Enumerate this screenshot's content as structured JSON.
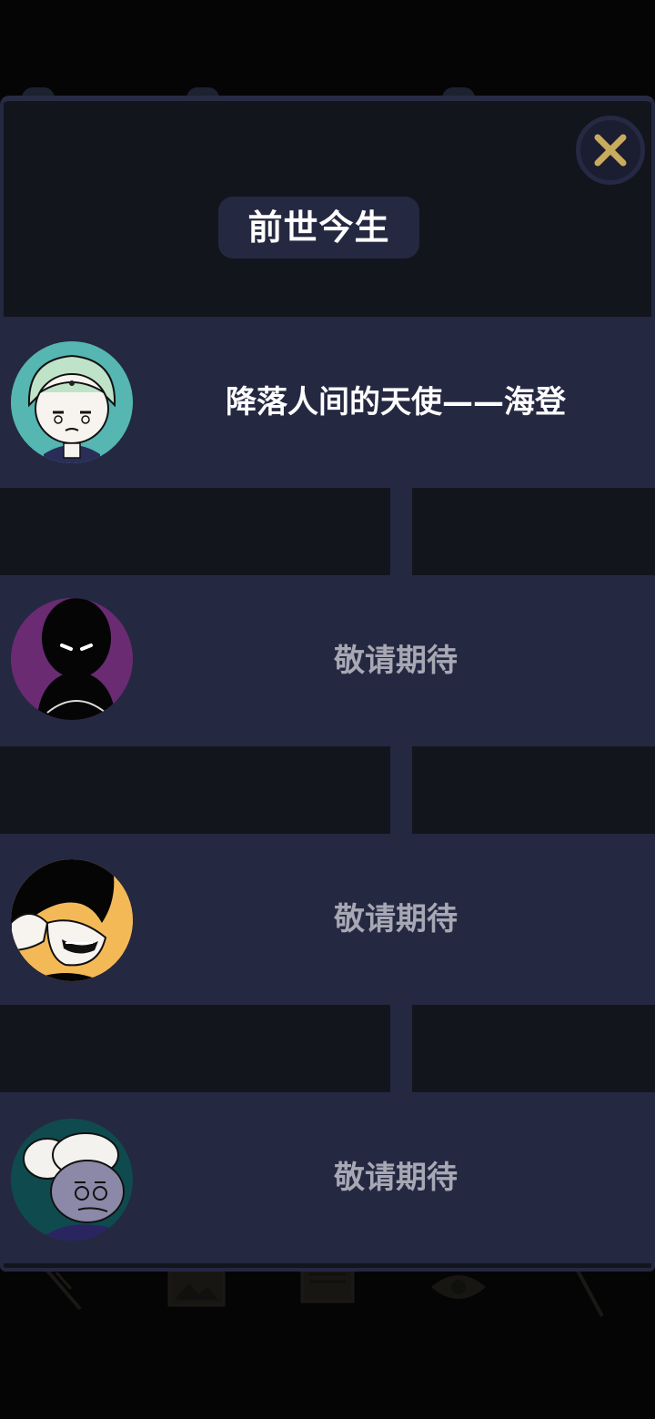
{
  "panel": {
    "title": "前世今生",
    "close_icon": "close-x-icon"
  },
  "entries": [
    {
      "label": "降落人间的天使——海登",
      "locked": false,
      "avatar": "angel-haideng-avatar"
    },
    {
      "label": "敬请期待",
      "locked": true,
      "avatar": "shadow-figure-avatar"
    },
    {
      "label": "敬请期待",
      "locked": true,
      "avatar": "grinning-figure-avatar"
    },
    {
      "label": "敬请期待",
      "locked": true,
      "avatar": "old-man-avatar"
    }
  ],
  "colors": {
    "background": "#050506",
    "panel": "#13151d",
    "card": "#252841",
    "accent_gold": "#c9ab5e",
    "label_unlocked": "#ffffff",
    "label_locked": "#a7a8b4"
  }
}
